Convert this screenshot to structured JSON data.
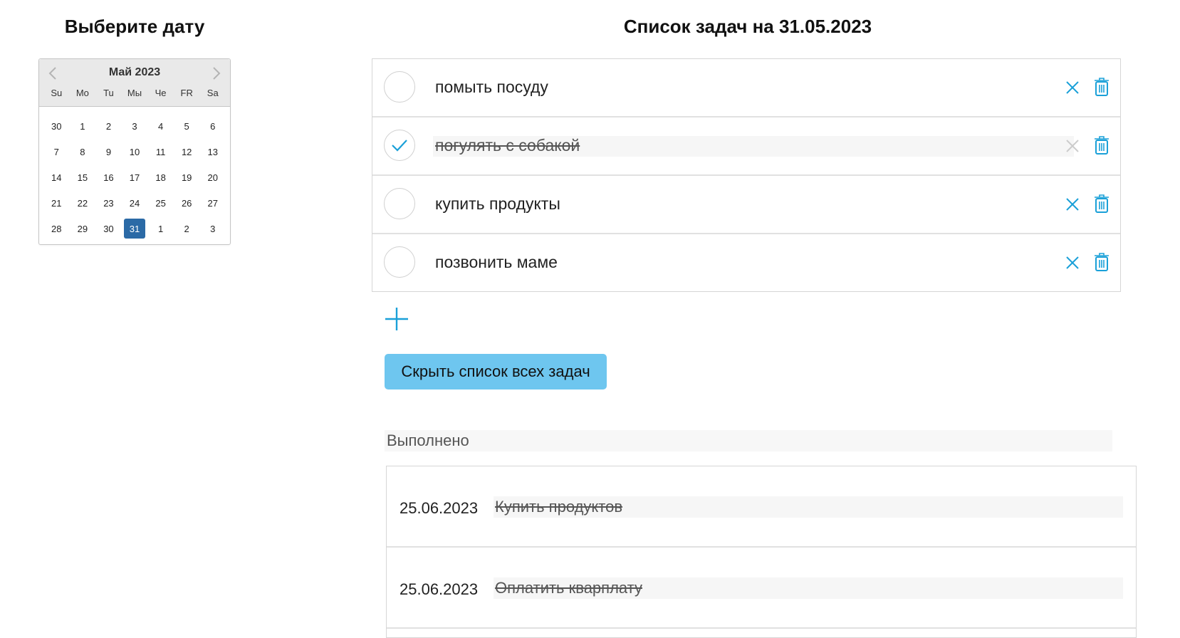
{
  "left": {
    "heading": "Выберите дату"
  },
  "calendar": {
    "title": "Май 2023",
    "weekdays": [
      "Su",
      "Mo",
      "Tu",
      "Мы",
      "Че",
      "FR",
      "Sa"
    ],
    "weeks": [
      [
        "30",
        "1",
        "2",
        "3",
        "4",
        "5",
        "6"
      ],
      [
        "7",
        "8",
        "9",
        "10",
        "11",
        "12",
        "13"
      ],
      [
        "14",
        "15",
        "16",
        "17",
        "18",
        "19",
        "20"
      ],
      [
        "21",
        "22",
        "23",
        "24",
        "25",
        "26",
        "27"
      ],
      [
        "28",
        "29",
        "30",
        "31",
        "1",
        "2",
        "3"
      ]
    ],
    "selected_day": "31",
    "prev_icon": "chevron-left-icon",
    "next_icon": "chevron-right-icon"
  },
  "tasks": {
    "heading": "Список задач на 31.05.2023",
    "items": [
      {
        "text": "помыть посуду",
        "done": false
      },
      {
        "text": "погулять с собакой",
        "done": true
      },
      {
        "text": "купить продукты",
        "done": false
      },
      {
        "text": "позвонить маме",
        "done": false
      }
    ],
    "add_icon": "plus-icon",
    "hide_button_label": "Скрыть список всех задач"
  },
  "completed": {
    "title": "Выполнено",
    "items": [
      {
        "date": "25.06.2023",
        "text": "Купить продуктов"
      },
      {
        "date": "25.06.2023",
        "text": "Оплатить кварплату"
      }
    ]
  },
  "colors": {
    "accent": "#1aa0d8",
    "selected_day": "#2b6aa6",
    "button": "#6ec6ef"
  }
}
